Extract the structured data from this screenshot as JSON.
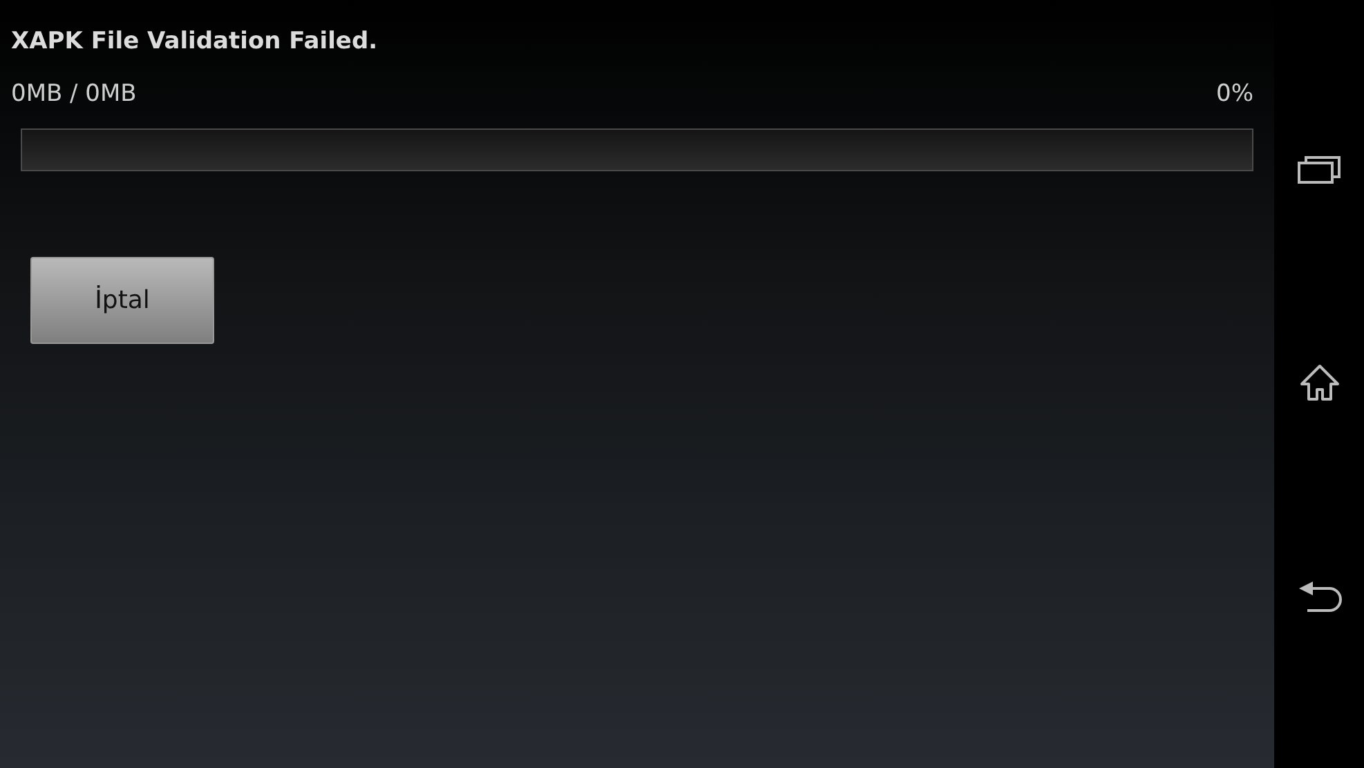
{
  "title": "XAPK File Validation Failed.",
  "progress": {
    "size": "0MB / 0MB",
    "percent": "0%",
    "level": 0
  },
  "buttons": [
    "İptal"
  ]
}
